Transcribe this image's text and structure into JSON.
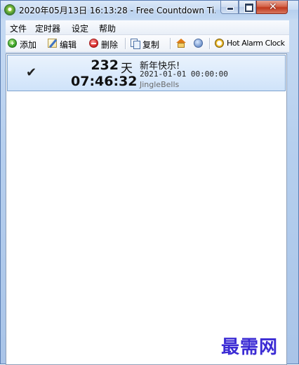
{
  "window": {
    "title": "2020年05月13日 16:13:28 - Free Countdown Ti..."
  },
  "menu": {
    "file": "文件",
    "timer": "定时器",
    "settings": "设定",
    "help": "帮助"
  },
  "toolbar": {
    "add": "添加",
    "edit": "编辑",
    "delete": "删除",
    "copy": "复制",
    "hot_alarm": "Hot Alarm Clock"
  },
  "timers": [
    {
      "checked": true,
      "check_mark": "✔",
      "days": "232",
      "days_unit": "天",
      "time": "07:46:32",
      "title": "新年快乐!",
      "target": "2021-01-01 00:00:00",
      "sound": "JingleBells"
    }
  ],
  "watermark": "最需网",
  "colors": {
    "selected_row": "#cfe3fa",
    "close_button": "#c0391d",
    "watermark": "#3b2bd4"
  }
}
